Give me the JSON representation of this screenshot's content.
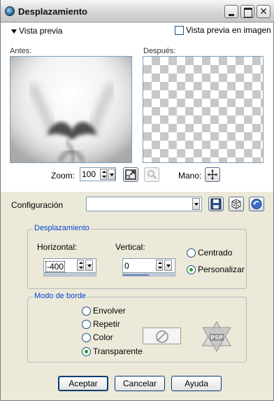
{
  "window": {
    "title": "Desplazamiento"
  },
  "preview": {
    "toggle_label": "Vista previa",
    "image_preview_label": "Vista previa en imagen",
    "image_preview_checked": false,
    "before_label": "Antes:",
    "after_label": "Después:"
  },
  "zoom": {
    "label": "Zoom:",
    "value": "100"
  },
  "pan": {
    "label": "Mano:"
  },
  "config": {
    "label": "Configuración",
    "selected": ""
  },
  "displacement": {
    "title": "Desplazamiento",
    "horizontal_label": "Horizontal:",
    "horizontal_value": "-400",
    "vertical_label": "Vertical:",
    "vertical_value": "0",
    "options": [
      {
        "label": "Centrado",
        "selected": false
      },
      {
        "label": "Personalizar",
        "selected": true
      }
    ]
  },
  "edge": {
    "title": "Modo de borde",
    "options": [
      {
        "label": "Envolver",
        "selected": false
      },
      {
        "label": "Repetir",
        "selected": false
      },
      {
        "label": "Color",
        "selected": false
      },
      {
        "label": "Transparente",
        "selected": true
      }
    ]
  },
  "buttons": {
    "ok": "Aceptar",
    "cancel": "Cancelar",
    "help": "Ayuda"
  },
  "colors": {
    "accent": "#0046d5",
    "dialog_bg": "#ece9d8",
    "radio_dot": "#21a121"
  }
}
